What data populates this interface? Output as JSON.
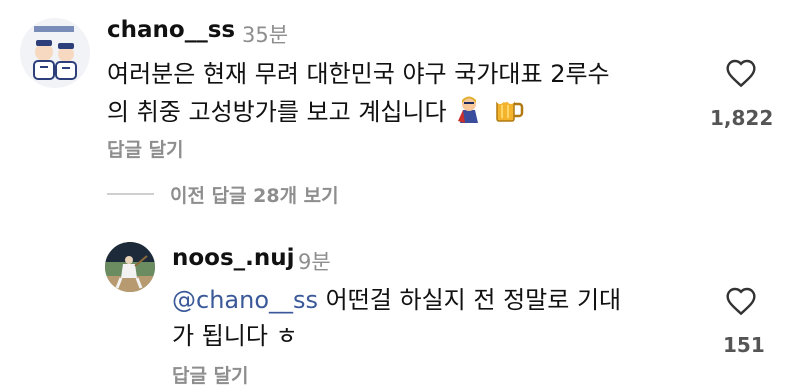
{
  "comments": [
    {
      "username": "chano__ss",
      "time": "35분",
      "text_line1": "여러분은 현재 무려 대한민국 야구 국가대표 2루수",
      "text_line2": "의 취중 고성방가를 보고 계십니다",
      "emojis": [
        "superhero-emoji",
        "beer-mug-emoji"
      ],
      "reply_label": "답글 달기",
      "like_count": "1,822"
    }
  ],
  "view_replies_label": "이전 답글 28개 보기",
  "replies": [
    {
      "username": "noos_.nuj",
      "time": "9분",
      "mention": "@chano__ss",
      "text_line1_rest": " 어떤걸 하실지 전 정말로 기대",
      "text_line2": "가 됩니다 ㅎ",
      "reply_label": "답글 달기",
      "like_count": "151"
    }
  ],
  "colors": {
    "username": "#111111",
    "meta": "#8e8e8e",
    "mention": "#3b5998",
    "divider": "#cfcfcf"
  }
}
